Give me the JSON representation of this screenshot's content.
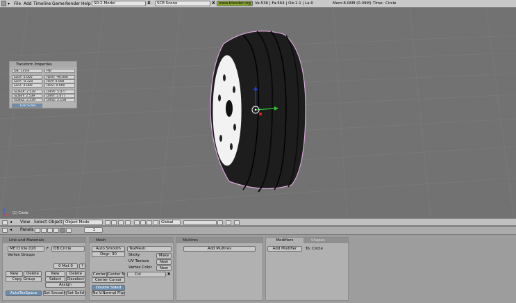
{
  "menu": {
    "items": [
      "File",
      "Add",
      "Timeline",
      "Game",
      "Render",
      "Help"
    ],
    "screen": "SR:2-Model",
    "scene": "SCE:Scene",
    "url": "www.blender.org 249.2",
    "stats": "Ve:536 | Fa:564 | Ob:1-1 | La:0",
    "mem": "Mem:8.08M (0.09M)",
    "time": "Time:",
    "obj": "Circle"
  },
  "transform": {
    "title": "Transform Properties",
    "ob": "OB: Circle",
    "par": "Par:",
    "locx": "LocX: 0.000",
    "locy": "LocY: -0.120",
    "locz": "LocZ: 0.000",
    "rotx": "RotX: -90.000",
    "roty": "RotY: 0.000",
    "rotz": "RotZ: 0.000",
    "scalex": "ScaleX: 2.539",
    "scaley": "ScaleY: 2.539",
    "scalez": "ScaleZ: 2.539",
    "dimx": "DimX: 5.077",
    "dimy": "DimY: 5.077",
    "dimz": "DimZ: 2.158",
    "link": "Link Scale"
  },
  "viewport": {
    "label": "(1) Circle"
  },
  "view_header": {
    "menus": [
      "View",
      "Select",
      "Object"
    ],
    "mode": "Object Mode",
    "orient": "Global"
  },
  "buttons_header": {
    "panels": "Panels",
    "page": "1"
  },
  "links": {
    "title": "Link and Materials",
    "me": "ME:Circle.020",
    "f": "F",
    "ob": "OB:Circle",
    "vgroups": "Vertex Groups",
    "mat": "0 Mat 0",
    "q": "?",
    "new": "New",
    "delete": "Delete",
    "copy_group": "Copy Group",
    "new2": "New",
    "delete2": "Delete",
    "select": "Select",
    "deselect": "Deselect",
    "assign": "Assign",
    "autotex": "AutoTexSpace",
    "set_smooth": "Set Smooth",
    "set_solid": "Set Solid"
  },
  "mesh": {
    "title": "Mesh",
    "auto_smooth": "Auto Smooth",
    "degr": "Degr: 30",
    "texmesh": "TexMesh:",
    "sticky": "Sticky",
    "make": "Make",
    "uvtex": "UV Texture",
    "new1": "New",
    "vcol": "Vertex Color",
    "new2": "New",
    "col": "Col",
    "center": "Center",
    "center_new": "Center New",
    "center_cursor": "Center Cursor",
    "double_sided": "Double Sided",
    "no_v_normal": "No V.Normal Flip"
  },
  "multires": {
    "title": "Multires",
    "add": "Add Multires"
  },
  "modifiers": {
    "tab1": "Modifiers",
    "tab2": "Shapes",
    "add": "Add Modifier",
    "to": "To: Circle"
  },
  "colors": {
    "bg": "#6b6b6b",
    "grid": "#7c7c7c",
    "tire": "#1d1d1d",
    "rim": "#f2f2f2",
    "axis_x": "#d02020",
    "axis_y": "#30c030",
    "axis_z": "#2040d0"
  }
}
